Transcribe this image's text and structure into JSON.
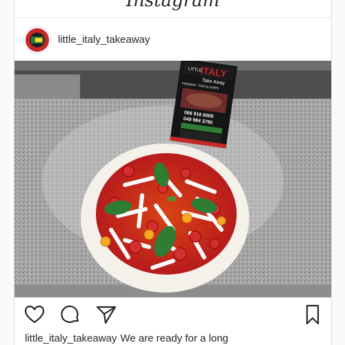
{
  "app": {
    "title": "Instagram"
  },
  "post": {
    "username": "little_italy_takeaway",
    "caption_user": "little_italy_takeaway",
    "caption_text": "We are ready for a long"
  },
  "flyer": {
    "brand_small": "LITTLE",
    "brand_big": "ITALY",
    "subtitle": "Take Away",
    "tagline": "PIZZERIA · FISH & CHIPS",
    "phone1": "066 916 6000",
    "phone2": "049 984 3790"
  },
  "icons": {
    "like": "heart-icon",
    "comment": "comment-icon",
    "share": "send-icon",
    "save": "bookmark-icon"
  },
  "colors": {
    "text": "#262626",
    "border": "#dbdbdb",
    "flyer_red": "#c62828",
    "flyer_green": "#2e7d32"
  }
}
